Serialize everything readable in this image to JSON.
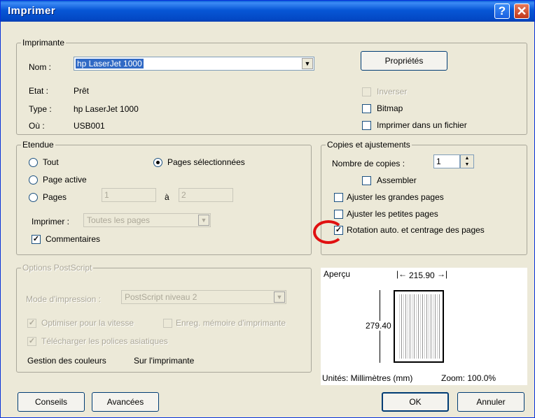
{
  "window": {
    "title": "Imprimer",
    "help_glyph": "?",
    "close_glyph": "✕"
  },
  "printer": {
    "legend": "Imprimante",
    "name_label": "Nom :",
    "name_value": "hp LaserJet 1000",
    "properties_button": "Propriétés",
    "status_label": "Etat :",
    "status_value": "Prêt",
    "type_label": "Type :",
    "type_value": "hp LaserJet 1000",
    "where_label": "Où :",
    "where_value": "USB001",
    "reverse_label": "Inverser",
    "bitmap_label": "Bitmap",
    "print_to_file_label": "Imprimer dans un fichier"
  },
  "range": {
    "legend": "Etendue",
    "all_label": "Tout",
    "selection_label": "Pages sélectionnées",
    "current_label": "Page active",
    "pages_label": "Pages",
    "from_value": "1",
    "to_label": "à",
    "to_value": "2",
    "print_label": "Imprimer :",
    "print_value": "Toutes les pages",
    "comments_label": "Commentaires"
  },
  "copies": {
    "legend": "Copies et ajustements",
    "count_label": "Nombre de copies :",
    "count_value": "1",
    "collate_label": "Assembler",
    "fit_large_label": "Ajuster les grandes pages",
    "fit_small_label": "Ajuster les petites pages",
    "auto_rotate_label": "Rotation auto. et centrage des pages"
  },
  "postscript": {
    "legend": "Options PostScript",
    "mode_label": "Mode d'impression :",
    "mode_value": "PostScript niveau 2",
    "optimize_label": "Optimiser pour la vitesse",
    "save_memory_label": "Enreg. mémoire d'imprimante",
    "download_fonts_label": "Télécharger les polices asiatiques",
    "color_mgmt_label": "Gestion des couleurs",
    "color_mgmt_value": "Sur l'imprimante"
  },
  "preview": {
    "title": "Aperçu",
    "width_value": "215.90",
    "height_value": "279.40",
    "units": "Unités: Millimètres (mm)",
    "zoom": "Zoom: 100.0%"
  },
  "footer": {
    "tips_button": "Conseils",
    "advanced_button": "Avancées",
    "ok_button": "OK",
    "cancel_button": "Annuler"
  },
  "colors": {
    "title_bar": "#0756d6",
    "dialog_bg": "#ece9d8",
    "selection": "#316ac5",
    "annotation": "#e01010"
  }
}
